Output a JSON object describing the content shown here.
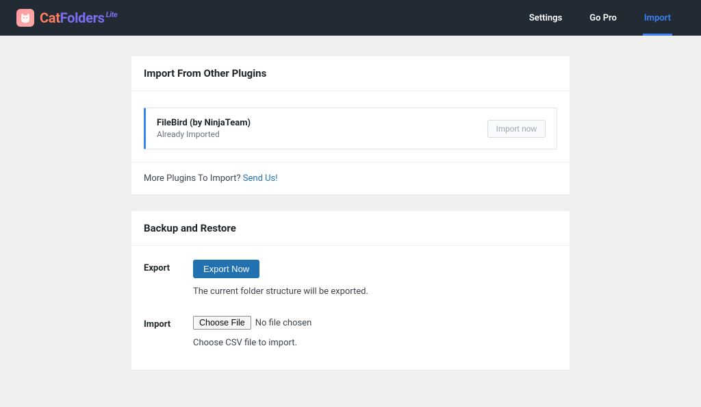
{
  "brand": {
    "part1": "Cat",
    "part2": "Folders",
    "suffix": "Lite"
  },
  "nav": {
    "settings": "Settings",
    "gopro": "Go Pro",
    "import": "Import"
  },
  "importPanel": {
    "title": "Import From Other Plugins",
    "plugin": {
      "name": "FileBird (by NinjaTeam)",
      "status": "Already Imported",
      "button": "Import now"
    },
    "morePluginsText": "More Plugins To Import? ",
    "sendUsLink": "Send Us!"
  },
  "backupPanel": {
    "title": "Backup and Restore",
    "export": {
      "label": "Export",
      "button": "Export Now",
      "desc": "The current folder structure will be exported."
    },
    "import": {
      "label": "Import",
      "chooseFile": "Choose File",
      "noFile": "No file chosen",
      "desc": "Choose CSV file to import."
    }
  }
}
